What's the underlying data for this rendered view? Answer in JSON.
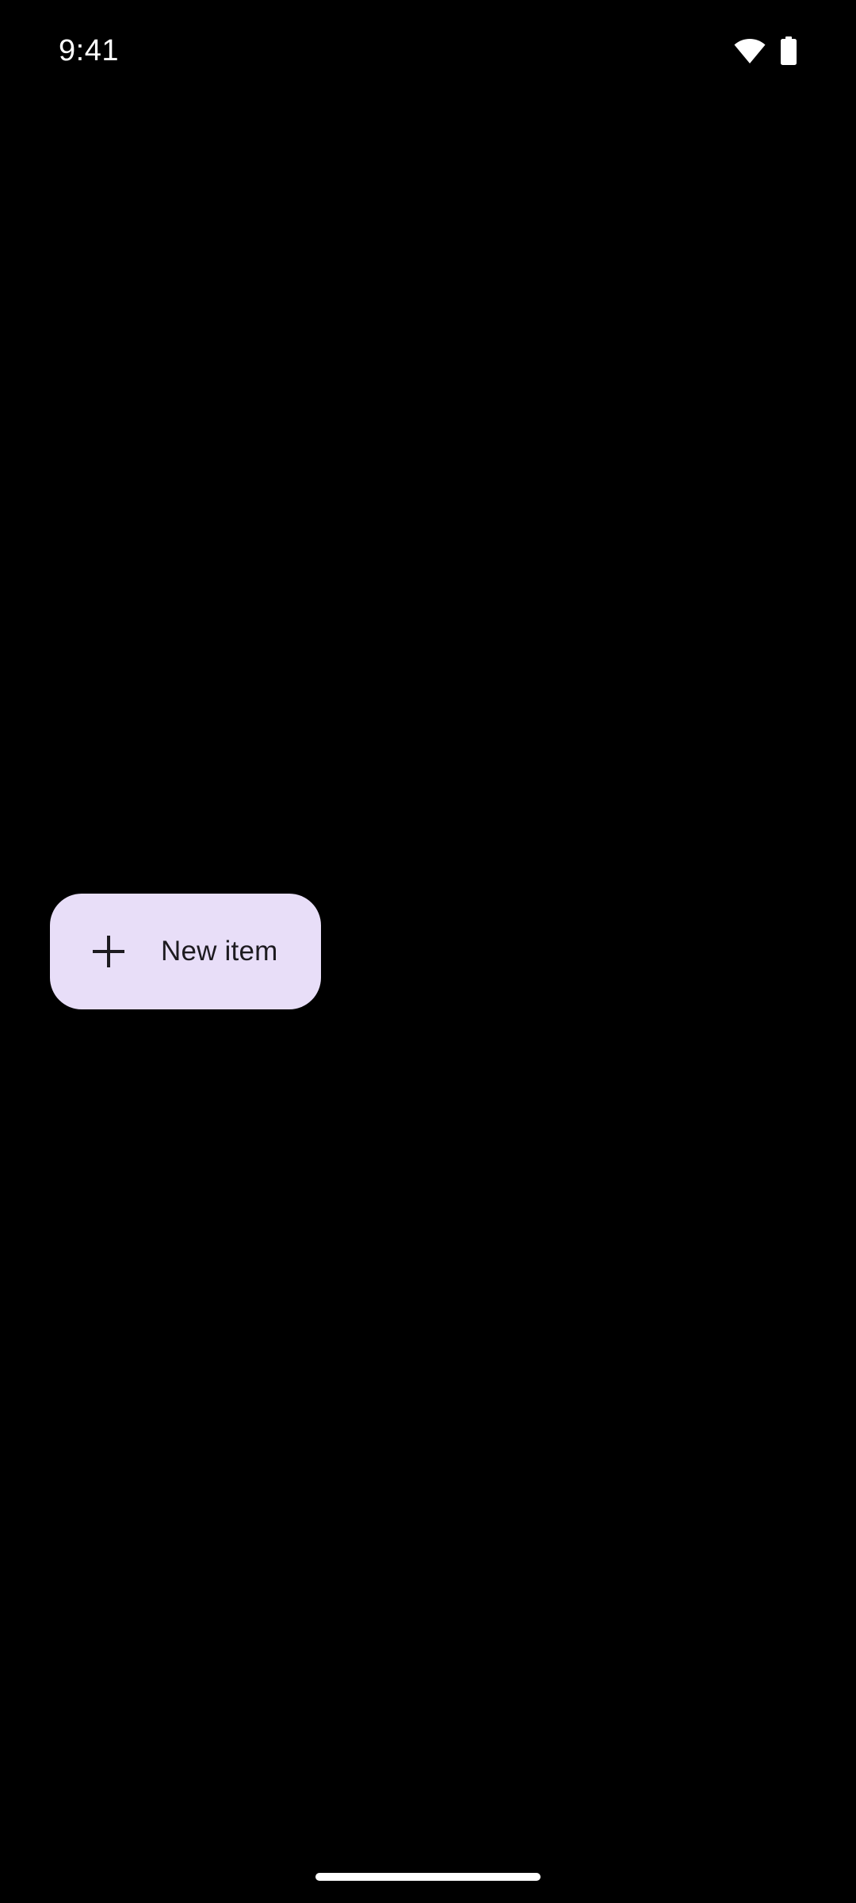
{
  "status_bar": {
    "time": "9:41",
    "icons": [
      "wifi-icon",
      "battery-icon"
    ]
  },
  "fab": {
    "icon": "plus-icon",
    "label": "New item"
  },
  "colors": {
    "background": "#000000",
    "fab_container": "#e8def8",
    "fab_content": "#1d1b20",
    "status_foreground": "#ffffff"
  }
}
